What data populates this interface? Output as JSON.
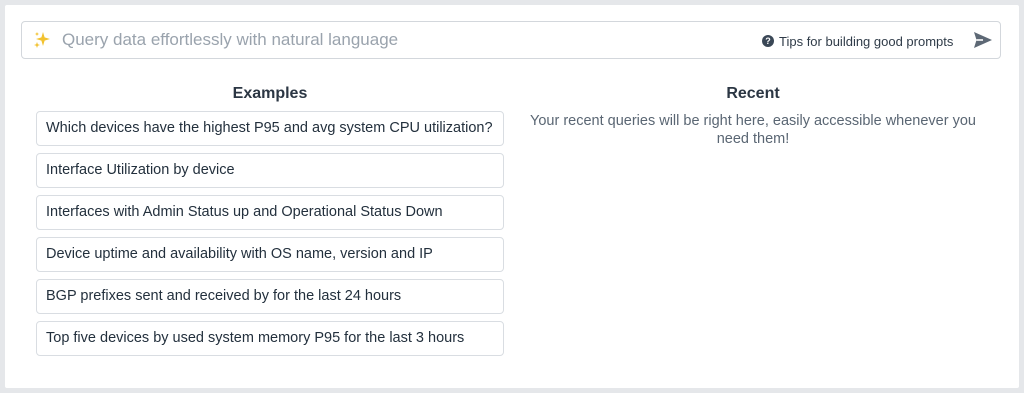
{
  "query": {
    "placeholder": "Query data effortlessly with natural language",
    "tips_label": "Tips for building good prompts",
    "tips_icon": "question-circle-icon",
    "sparkle_icon": "sparkle-icon",
    "send_icon": "send-icon",
    "accent_sparkle": "#f2c230"
  },
  "examples": {
    "heading": "Examples",
    "items": [
      "Which devices have the highest P95 and avg system CPU utilization?",
      "Interface Utilization by device",
      "Interfaces with Admin Status up and Operational Status Down",
      "Device uptime and availability with OS name, version and IP",
      "BGP prefixes sent and received by for the last 24 hours",
      "Top five devices by used system memory P95 for the last 3 hours"
    ]
  },
  "recent": {
    "heading": "Recent",
    "empty_message": "Your recent queries will be right here, easily accessible whenever you need them!"
  }
}
